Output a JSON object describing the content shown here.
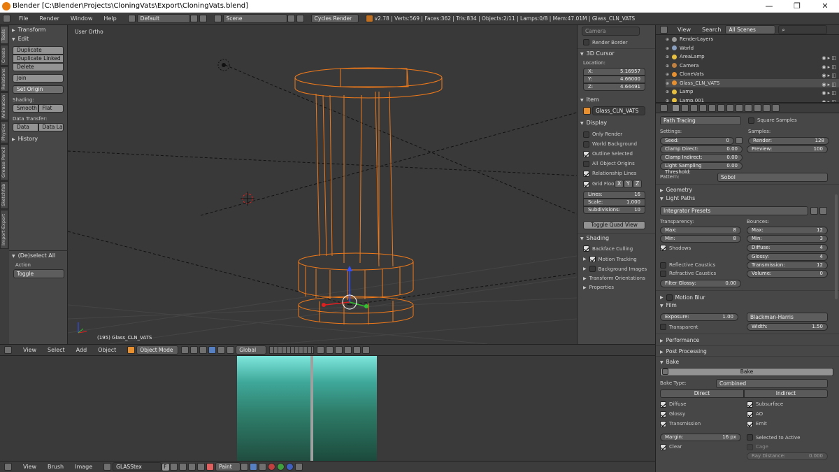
{
  "window": {
    "title": "Blender [C:\\Blender\\Projects\\CloningVats\\Export\\CloningVats.blend]",
    "minimize": "—",
    "maximize": "❐",
    "close": "✕"
  },
  "info": {
    "menus": [
      "File",
      "Render",
      "Window",
      "Help"
    ],
    "screen": "Default",
    "scene": "Scene",
    "engine": "Cycles Render",
    "stats": "v2.78 | Verts:569 | Faces:362 | Tris:834 | Objects:2/11 | Lamps:0/8 | Mem:47.01M | Glass_CLN_VATS"
  },
  "tool_tabs": [
    "Tools",
    "Create",
    "Relations",
    "Animation",
    "Physics",
    "Grease Pencil",
    "Sketchfab",
    "Import-Export"
  ],
  "toolshelf": {
    "transform": "Transform",
    "edit": "Edit",
    "duplicate": "Duplicate",
    "duplicate_linked": "Duplicate Linked",
    "delete": "Delete",
    "join": "Join",
    "set_origin": "Set Origin",
    "shading": "Shading:",
    "smooth": "Smooth",
    "flat": "Flat",
    "data_transfer": "Data Transfer:",
    "data": "Data",
    "data_lay": "Data Lay",
    "history": "History",
    "operator": "(De)select All",
    "action_label": "Action",
    "action_value": "Toggle"
  },
  "viewport": {
    "view_name": "User Ortho",
    "object_label": "(195) Glass_CLN_VATS"
  },
  "npanel": {
    "camera_field": "Camera",
    "render_border": "Render Border",
    "cursor_header": "3D Cursor",
    "location": "Location:",
    "x_label": "X:",
    "x_value": "5.16957",
    "y_label": "Y:",
    "y_value": "4.66000",
    "z_label": "Z:",
    "z_value": "4.64491",
    "item_header": "Item",
    "item_name": "Glass_CLN_VATS",
    "display_header": "Display",
    "only_render": "Only Render",
    "world_background": "World Background",
    "outline_selected": "Outline Selected",
    "all_object_origins": "All Object Origins",
    "relationship_lines": "Relationship Lines",
    "grid_floor": "Grid Floo",
    "ax_x": "X",
    "ax_y": "Y",
    "ax_z": "Z",
    "lines_label": "Lines:",
    "lines_value": "16",
    "scale_label": "Scale:",
    "scale_value": "1.000",
    "subdiv_label": "Subdivisions:",
    "subdiv_value": "10",
    "toggle_quad": "Toggle Quad View",
    "shading_header": "Shading",
    "backface_culling": "Backface Culling",
    "motion_tracking": "Motion Tracking",
    "background_images": "Background Images",
    "transform_orientations": "Transform Orientations",
    "properties": "Properties"
  },
  "header3d": {
    "menus": [
      "View",
      "Select",
      "Add",
      "Object"
    ],
    "mode": "Object Mode",
    "orientation": "Global"
  },
  "imgheader": {
    "menus": [
      "View",
      "Brush",
      "Image"
    ],
    "image_name": "GLASStex",
    "f_label": "F",
    "paint": "Paint"
  },
  "outliner": {
    "view": "View",
    "search": "Search",
    "scenes": "All Scenes",
    "items": [
      {
        "name": "RenderLayers",
        "color": "#9a9a9a"
      },
      {
        "name": "World",
        "color": "#8aa0c0"
      },
      {
        "name": "AreaLamp",
        "color": "#e8c040"
      },
      {
        "name": "Camera",
        "color": "#c08040"
      },
      {
        "name": "CloneVats",
        "color": "#e89030"
      },
      {
        "name": "Glass_CLN_VATS",
        "color": "#e89030"
      },
      {
        "name": "Lamp",
        "color": "#e8c040"
      },
      {
        "name": "Lamp.001",
        "color": "#e8c040"
      }
    ]
  },
  "render_props": {
    "integrator": "Path Tracing",
    "square_samples": "Square Samples",
    "settings": "Settings:",
    "samples": "Samples:",
    "seed_label": "Seed:",
    "seed_value": "0",
    "render_label": "Render:",
    "render_value": "128",
    "clamp_direct_label": "Clamp Direct:",
    "clamp_direct_value": "0.00",
    "preview_label": "Preview:",
    "preview_value": "100",
    "clamp_indirect_label": "Clamp Indirect:",
    "clamp_indirect_value": "0.00",
    "lst_label": "Light Sampling Threshold:",
    "lst_value": "0.00",
    "pattern_label": "Pattern:",
    "pattern_value": "Sobol",
    "geometry": "Geometry",
    "light_paths": "Light Paths",
    "integrator_presets": "Integrator Presets",
    "transparency": "Transparency:",
    "bounces": "Bounces:",
    "t_max_label": "Max:",
    "t_max_value": "8",
    "t_min_label": "Min:",
    "t_min_value": "8",
    "b_max_label": "Max:",
    "b_max_value": "12",
    "b_min_label": "Min:",
    "b_min_value": "3",
    "shadows": "Shadows",
    "diffuse_label": "Diffuse:",
    "diffuse_value": "4",
    "glossy_label": "Glossy:",
    "glossy_value": "4",
    "reflective_caustics": "Reflective Caustics",
    "transmission_label": "Transmission:",
    "transmission_value": "12",
    "refractive_caustics": "Refractive Caustics",
    "volume_label": "Volume:",
    "volume_value": "0",
    "filter_glossy_label": "Filter Glossy:",
    "filter_glossy_value": "0.00",
    "motion_blur": "Motion Blur",
    "film": "Film",
    "exposure_label": "Exposure:",
    "exposure_value": "1.00",
    "filter_type": "Blackman-Harris",
    "transparent": "Transparent",
    "width_label": "Width:",
    "width_value": "1.50",
    "performance": "Performance",
    "post_processing": "Post Processing",
    "bake_header": "Bake",
    "bake_button": "Bake",
    "bake_type_label": "Bake Type:",
    "bake_type_value": "Combined",
    "direct": "Direct",
    "indirect": "Indirect",
    "b_diffuse": "Diffuse",
    "b_subsurface": "Subsurface",
    "b_glossy": "Glossy",
    "b_ao": "AO",
    "b_transmission": "Transmission",
    "b_emit": "Emit",
    "margin_label": "Margin:",
    "margin_value": "16 px",
    "selected_to_active": "Selected to Active",
    "clear": "Clear",
    "cage": "Cage",
    "ray_distance_label": "Ray Distance:",
    "ray_distance_value": "0.000"
  },
  "colors": {
    "accent": "#e87d0d",
    "selection": "#f07a1a",
    "header_bg": "#3c3c3c",
    "panel_bg": "#474747"
  }
}
